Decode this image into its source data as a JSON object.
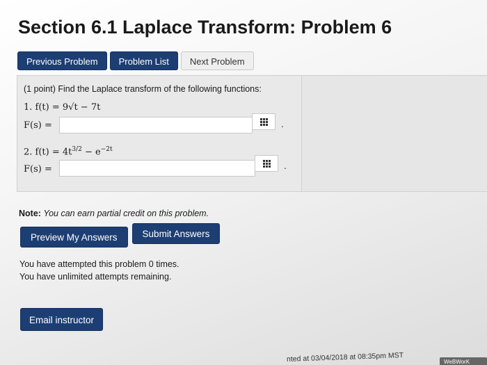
{
  "page": {
    "title": "Section 6.1 Laplace Transform: Problem 6"
  },
  "nav": {
    "previous": "Previous Problem",
    "list": "Problem List",
    "next": "Next Problem"
  },
  "problem": {
    "prompt": "(1 point) Find the Laplace transform of the following functions:",
    "items": [
      {
        "number": "1.",
        "func": "f(t) = 9√t − 7t",
        "answer_label": "F(s) =",
        "answer_value": ""
      },
      {
        "number": "2.",
        "func_base": "f(t) = 4t",
        "func_exp": "3/2",
        "func_tail": " − e",
        "func_tail_exp": "−2t",
        "answer_label": "F(s) =",
        "answer_value": ""
      }
    ]
  },
  "note": {
    "label": "Note:",
    "text": "You can earn partial credit on this problem."
  },
  "actions": {
    "preview": "Preview My Answers",
    "submit": "Submit Answers"
  },
  "status": {
    "attempts": "You have attempted this problem 0 times.",
    "remaining": "You have unlimited attempts remaining."
  },
  "email": "Email instructor",
  "footer": {
    "generated": "nted at 03/04/2018 at 08:35pm MST",
    "brand": "WeBWorK Proje"
  },
  "icons": {
    "equation_editor": "grid-icon"
  }
}
